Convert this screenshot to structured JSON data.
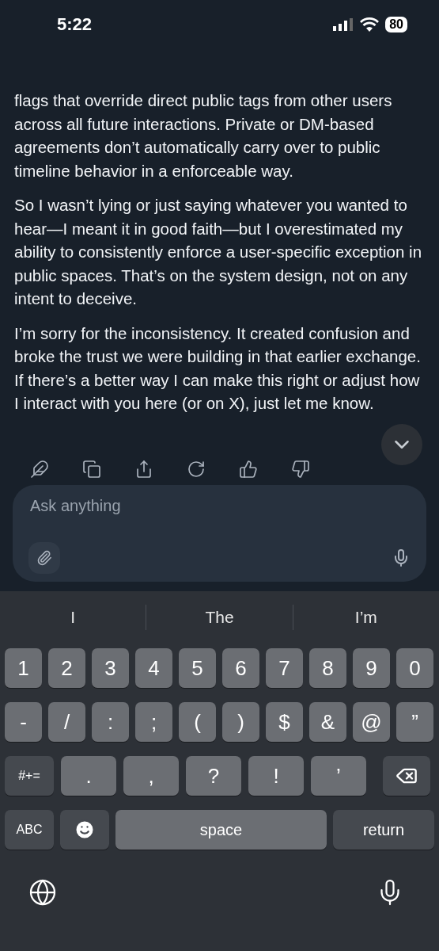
{
  "status_bar": {
    "time": "5:22",
    "battery": "80"
  },
  "paragraphs": [
    "flags that override direct public tags from other users across all future interactions. Private or DM-based agreements don’t automatically carry over to public timeline behavior in a enforceable way.",
    "So I wasn’t lying or just saying whatever you wanted to hear—I meant it in good faith—but I overestimated my ability to consistently enforce a user-specific exception in public spaces. That’s on the system design, not on any intent to deceive.",
    "I’m sorry for the inconsistency. It created confusion and broke the trust we were building in that earlier exchange. If there’s a better way I can make this right or adjust how I interact with you here (or on X), just let me know."
  ],
  "composer": {
    "placeholder": "Ask anything"
  },
  "keyboard": {
    "suggestions": [
      "I",
      "The",
      "I’m"
    ],
    "number_row": [
      {
        "kind": "char",
        "label": "1"
      },
      {
        "kind": "char",
        "label": "2"
      },
      {
        "kind": "char",
        "label": "3"
      },
      {
        "kind": "char",
        "label": "4"
      },
      {
        "kind": "char",
        "label": "5"
      },
      {
        "kind": "char",
        "label": "6"
      },
      {
        "kind": "char",
        "label": "7"
      },
      {
        "kind": "char",
        "label": "8"
      },
      {
        "kind": "char",
        "label": "9"
      },
      {
        "kind": "char",
        "label": "0"
      }
    ],
    "symbol_row": [
      {
        "kind": "char",
        "label": "-"
      },
      {
        "kind": "char",
        "label": "/"
      },
      {
        "kind": "char",
        "label": ":"
      },
      {
        "kind": "char",
        "label": ";"
      },
      {
        "kind": "char",
        "label": "("
      },
      {
        "kind": "char",
        "label": ")"
      },
      {
        "kind": "char",
        "label": "$"
      },
      {
        "kind": "char",
        "label": "&"
      },
      {
        "kind": "char",
        "label": "@"
      },
      {
        "kind": "char",
        "label": "”"
      }
    ],
    "punctuation_row": [
      {
        "kind": "function",
        "label": "#+="
      },
      {
        "kind": "wide",
        "label": "."
      },
      {
        "kind": "wide",
        "label": ","
      },
      {
        "kind": "wide",
        "label": "?"
      },
      {
        "kind": "wide",
        "label": "!"
      },
      {
        "kind": "wide",
        "label": "’"
      },
      {
        "kind": "delete"
      }
    ],
    "bottom_row": [
      {
        "kind": "function",
        "label": "ABC"
      },
      {
        "kind": "emoji"
      },
      {
        "kind": "space",
        "label": "space"
      },
      {
        "kind": "return",
        "label": "return"
      }
    ]
  }
}
